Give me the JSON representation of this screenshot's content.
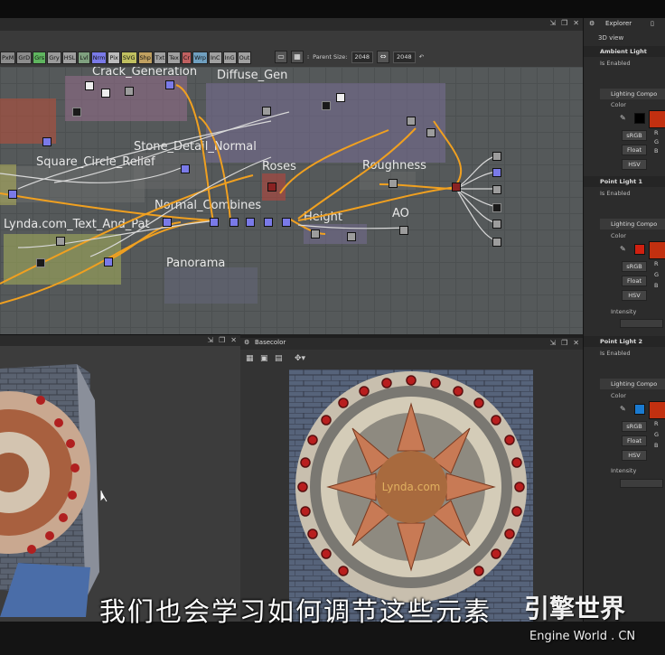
{
  "graph": {
    "filter_buttons": [
      {
        "label": "PxM",
        "color": "#8c8c8c"
      },
      {
        "label": "GrD",
        "color": "#8c8c8c"
      },
      {
        "label": "Grs",
        "color": "#5fb55f"
      },
      {
        "label": "Gry",
        "color": "#9a9a9a"
      },
      {
        "label": "HSL",
        "color": "#a0a0a0"
      },
      {
        "label": "Lvl",
        "color": "#7fa07f"
      },
      {
        "label": "Nrm",
        "color": "#7a7ae8"
      },
      {
        "label": "Pix",
        "color": "#bbbbbb"
      },
      {
        "label": "SVG",
        "color": "#c0c060"
      },
      {
        "label": "Shp",
        "color": "#c0a060"
      },
      {
        "label": "Txt",
        "color": "#a0a0a0"
      },
      {
        "label": "Tex",
        "color": "#a0a0a0"
      },
      {
        "label": "Cr",
        "color": "#c06060"
      },
      {
        "label": "Wrp",
        "color": "#70a0c0"
      },
      {
        "label": "InC",
        "color": "#a0a0a0"
      },
      {
        "label": "InG",
        "color": "#a0a0a0"
      },
      {
        "label": "Out",
        "color": "#a0a0a0"
      }
    ],
    "parent_size_label": "Parent Size:",
    "size_value_1": "2048",
    "size_value_2": "2048",
    "frames": [
      {
        "title": "Crack_Generation"
      },
      {
        "title": "Diffuse_Gen"
      },
      {
        "title": "Stone_Detail_Normal"
      },
      {
        "title": "Square_Circle_Relief"
      },
      {
        "title": "Roses"
      },
      {
        "title": "Roughness"
      },
      {
        "title": "Normal_Combines"
      },
      {
        "title": "Lynda.com_Text_And_Pat"
      },
      {
        "title": "Height"
      },
      {
        "title": "AO"
      },
      {
        "title": "Panorama"
      }
    ]
  },
  "views": {
    "basecolor_title": "Basecolor",
    "texture_text": "Lynda.com"
  },
  "explorer": {
    "tab_label": "Explorer",
    "view_label": "3D view",
    "sections": [
      {
        "title": "Ambient Light",
        "enabled": "Is Enabled"
      },
      {
        "title": "Lighting Compo",
        "color_label": "Color",
        "btns": [
          "sRGB",
          "Float",
          "HSV"
        ],
        "rgb": [
          "R",
          "G",
          "B"
        ],
        "swatch": "#000000",
        "bar": "#c23010"
      },
      {
        "title": "Point Light 1",
        "enabled": "Is Enabled"
      },
      {
        "title": "Lighting Compo",
        "color_label": "Color",
        "btns": [
          "sRGB",
          "Float",
          "HSV"
        ],
        "rgb": [
          "R",
          "G",
          "B"
        ],
        "swatch": "#d02010",
        "bar": "#c23010",
        "intensity": "Intensity"
      },
      {
        "title": "Point Light 2",
        "enabled": "Is Enabled"
      },
      {
        "title": "Lighting Compo",
        "color_label": "Color",
        "btns": [
          "sRGB",
          "Float",
          "HSV"
        ],
        "rgb": [
          "R",
          "G",
          "B"
        ],
        "swatch": "#1a7ad0",
        "bar": "#c23010",
        "intensity": "Intensity"
      }
    ]
  },
  "subtitle": "我们也会学习如何调节这些元素",
  "watermark": {
    "cn": "引擎世界",
    "en": "Engine World . CN"
  }
}
